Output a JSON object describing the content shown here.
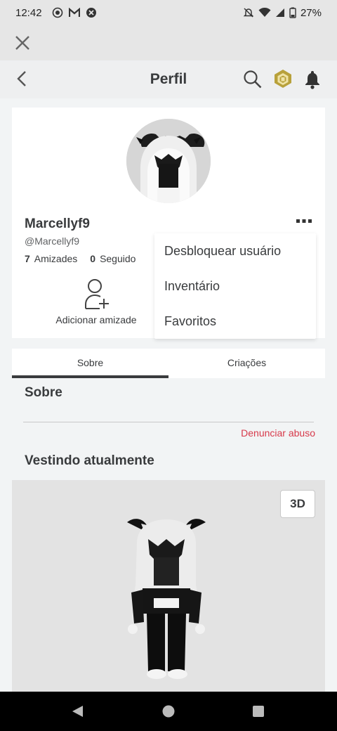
{
  "status_bar": {
    "time": "12:42",
    "battery": "27%",
    "left_icons": [
      "record-icon",
      "gmail-icon",
      "close-circle-icon"
    ],
    "right_icons": [
      "mute-icon",
      "wifi-icon",
      "signal-icon",
      "battery-icon"
    ]
  },
  "header": {
    "title": "Perfil",
    "icons": [
      "back-icon",
      "search-icon",
      "robux-icon",
      "bell-icon"
    ]
  },
  "profile": {
    "display_name": "Marcellyf9",
    "username": "@Marcellyf9",
    "friends_count": "7",
    "friends_label": "Amizades",
    "following_count": "0",
    "following_label": "Seguido",
    "add_friend_label": "Adicionar amizade"
  },
  "menu": {
    "items": [
      {
        "label": "Desbloquear usuário"
      },
      {
        "label": "Inventário"
      },
      {
        "label": "Favoritos"
      }
    ]
  },
  "tabs": [
    {
      "label": "Sobre",
      "active": true
    },
    {
      "label": "Criações",
      "active": false
    }
  ],
  "about": {
    "title": "Sobre",
    "report_label": "Denunciar abuso"
  },
  "wearing": {
    "title": "Vestindo atualmente",
    "view_3d_label": "3D"
  },
  "colors": {
    "report": "#d7394a",
    "text": "#393b3d",
    "background": "#f2f4f5"
  }
}
